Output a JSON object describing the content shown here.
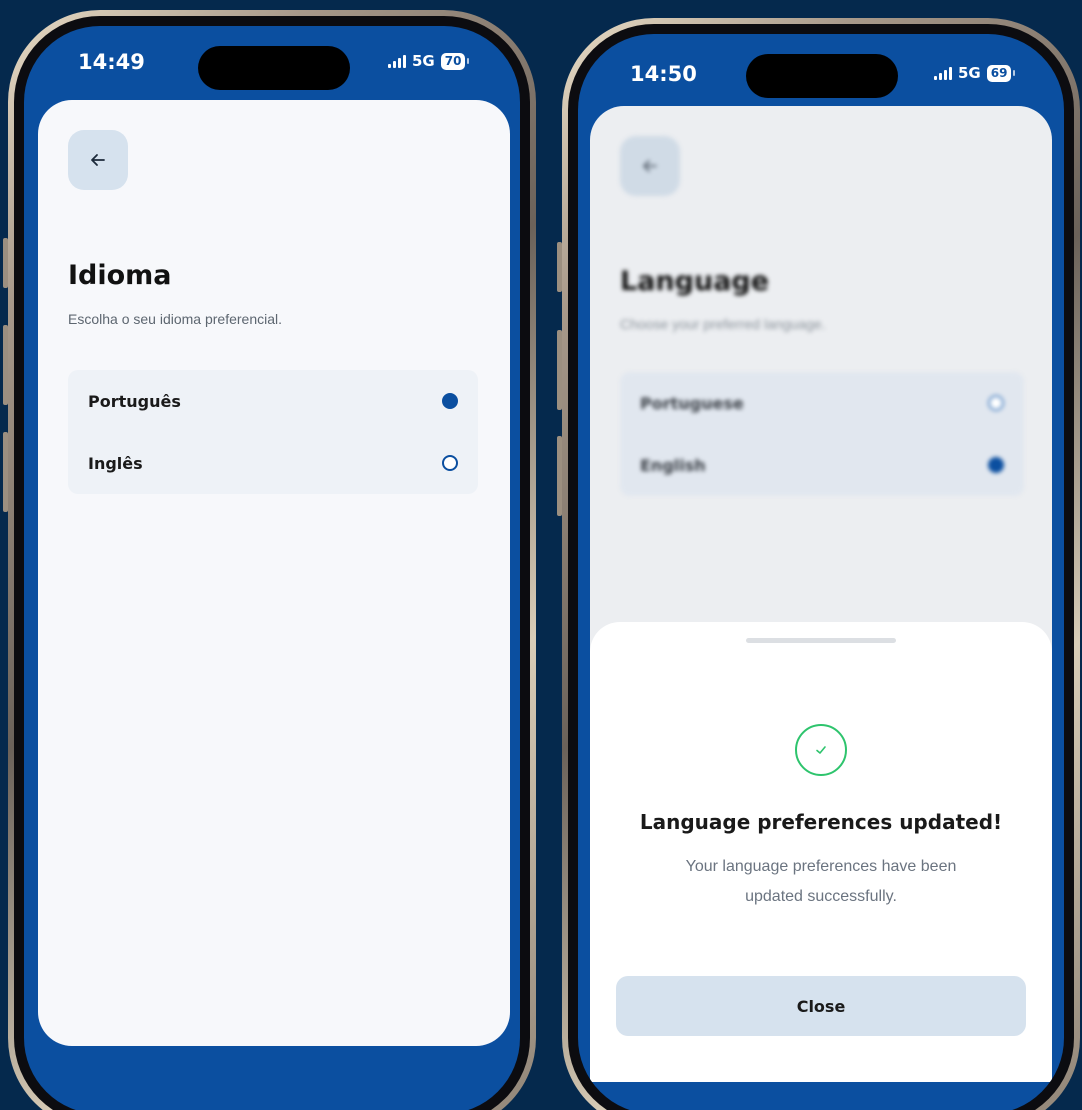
{
  "left_phone": {
    "status": {
      "time": "14:49",
      "network": "5G",
      "battery": "70"
    },
    "back_icon": "arrow-left-icon",
    "title": "Idioma",
    "subtitle": "Escolha o seu idioma preferencial.",
    "options": [
      {
        "label": "Português",
        "selected": true
      },
      {
        "label": "Inglês",
        "selected": false
      }
    ]
  },
  "right_phone": {
    "status": {
      "time": "14:50",
      "network": "5G",
      "battery": "69"
    },
    "back_icon": "arrow-left-icon",
    "title": "Language",
    "subtitle": "Choose your preferred language.",
    "options": [
      {
        "label": "Portuguese",
        "selected": false
      },
      {
        "label": "English",
        "selected": true
      }
    ],
    "sheet": {
      "icon": "check-circle-icon",
      "title": "Language preferences updated!",
      "message_line1": "Your language preferences have been",
      "message_line2": "updated successfully.",
      "close_label": "Close"
    }
  },
  "colors": {
    "background": "#05294d",
    "screen_blue": "#0b4fa0",
    "success_green": "#2ec46d",
    "button_bg": "#d6e2ee"
  }
}
